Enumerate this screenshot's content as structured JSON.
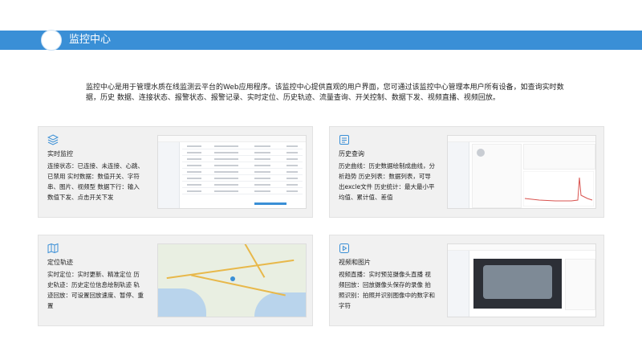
{
  "header": {
    "title": "监控中心"
  },
  "intro": {
    "text": "监控中心是用于管理水质在线监测云平台的Web应用程序。该监控中心提供直观的用户界面，您可通过该监控中心管理本用户所有设备，如查询实时数据，历史 数据、连接状态、报警状态、报警记录、实时定位、历史轨迹、流量查询、开关控制、数据下发、视频直播、视频回放。"
  },
  "cards": [
    {
      "icon": "layers-icon",
      "title": "实时监控",
      "desc": "连接状态：已连接、未连接、心跳、已禁用 实时数据：数值开关、字符串、图片、视频型 数据下行：输入数值下发、点击开关下发"
    },
    {
      "icon": "document-chart-icon",
      "title": "历史查询",
      "desc": "历史曲线：历史数据绘制成曲线，分析趋势 历史列表：数据列表，可导出excle文件 历史统计：最大最小平均值、累计值、差值"
    },
    {
      "icon": "map-icon",
      "title": "定位轨迹",
      "desc": "实时定位：实时更新、精准定位 历史轨迹：历史定位信息绘制轨迹 轨迹回放：可设置回放速度、暂停、重置"
    },
    {
      "icon": "play-icon",
      "title": "视频和图片",
      "desc": "视频直播：实时预览摄像头直播 视频回放：回放摄像头保存的录像 拍照识别：拍照并识别图像中的数字和字符"
    }
  ],
  "colors": {
    "accent": "#3a8fd6",
    "card_bg": "#f1f1f1"
  }
}
